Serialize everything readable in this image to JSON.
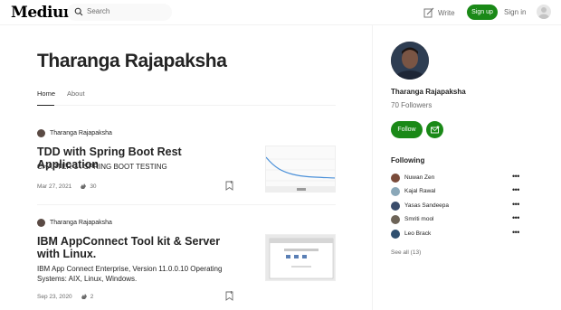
{
  "header": {
    "logo": "Medium",
    "search_placeholder": "Search",
    "write_label": "Write",
    "signup_label": "Sign up",
    "signin_label": "Sign in"
  },
  "profile": {
    "name": "Tharanga Rajapaksha",
    "tabs": [
      {
        "label": "Home",
        "active": true
      },
      {
        "label": "About",
        "active": false
      }
    ]
  },
  "posts": [
    {
      "author": "Tharanga Rajapaksha",
      "title": "TDD with Spring Boot Rest Application",
      "subtitle": "CHAPTER 1 : SPRING BOOT TESTING",
      "date": "Mar 27, 2021",
      "claps": "30"
    },
    {
      "author": "Tharanga Rajapaksha",
      "title": "IBM AppConnect Tool kit & Server with Linux.",
      "subtitle": "IBM App Connect Enterprise, Version 11.0.0.10 Operating Systems: AIX, Linux, Windows.",
      "date": "Sep 23, 2020",
      "claps": "2"
    }
  ],
  "sidebar": {
    "name": "Tharanga Rajapaksha",
    "followers": "70 Followers",
    "follow_label": "Follow",
    "following_heading": "Following",
    "following": [
      {
        "name": "Nuwan Zen",
        "color": "#7a4b3a"
      },
      {
        "name": "Kajal Rawal",
        "color": "#8aa7b8"
      },
      {
        "name": "Yasas Sandeepa",
        "color": "#3a4d6b"
      },
      {
        "name": "Smriti mool",
        "color": "#6d6458"
      },
      {
        "name": "Leo Brack",
        "color": "#2f4f6f"
      }
    ],
    "more_label": "•••",
    "see_all": "See all (13)"
  },
  "colors": {
    "accent": "#1a8917",
    "text": "#242424",
    "muted": "#6b6b6b"
  }
}
